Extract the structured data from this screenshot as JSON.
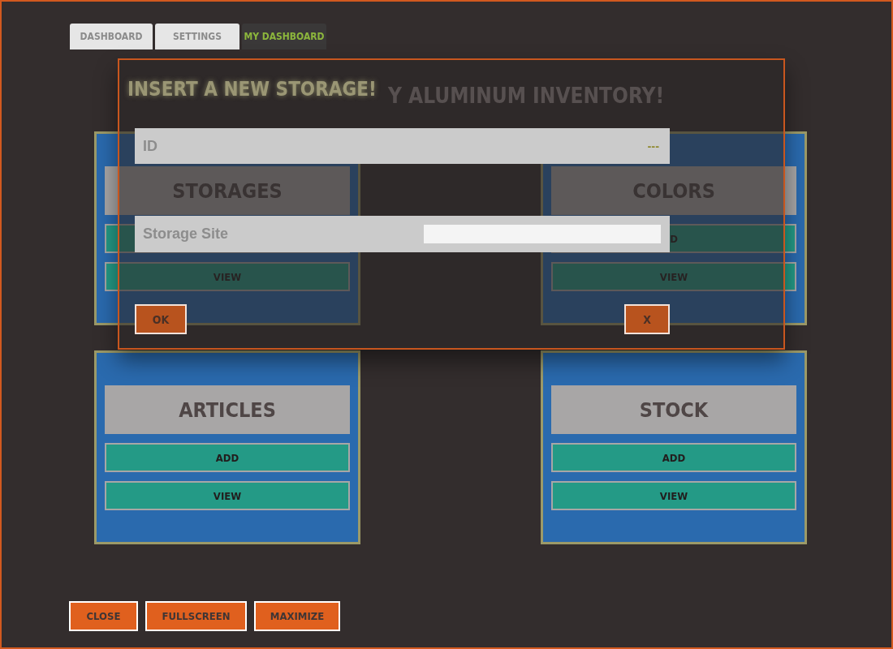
{
  "tabs": [
    {
      "label": "DASHBOARD",
      "selected": false
    },
    {
      "label": "SETTINGS",
      "selected": false
    },
    {
      "label": "MY DASHBOARD",
      "selected": true
    }
  ],
  "heading": "Y ALUMINUM INVENTORY!",
  "cards": [
    {
      "title": "STORAGES",
      "buttons": [
        "VIEW"
      ]
    },
    {
      "title": "COLORS",
      "buttons": [
        "D",
        "VIEW"
      ]
    },
    {
      "title": "ARTICLES",
      "buttons": [
        "ADD",
        "VIEW"
      ]
    },
    {
      "title": "STOCK",
      "buttons": [
        "ADD",
        "VIEW"
      ]
    }
  ],
  "dialog": {
    "title": "INSERT A NEW STORAGE!",
    "fields": [
      {
        "label": "ID",
        "kind": "readonly",
        "value": "---"
      },
      {
        "label": "Storage Site",
        "kind": "input"
      }
    ],
    "buttons": [
      "OK",
      "X"
    ]
  },
  "footer_buttons": [
    "CLOSE",
    "FULLSCREEN",
    "MAXIMIZE"
  ]
}
